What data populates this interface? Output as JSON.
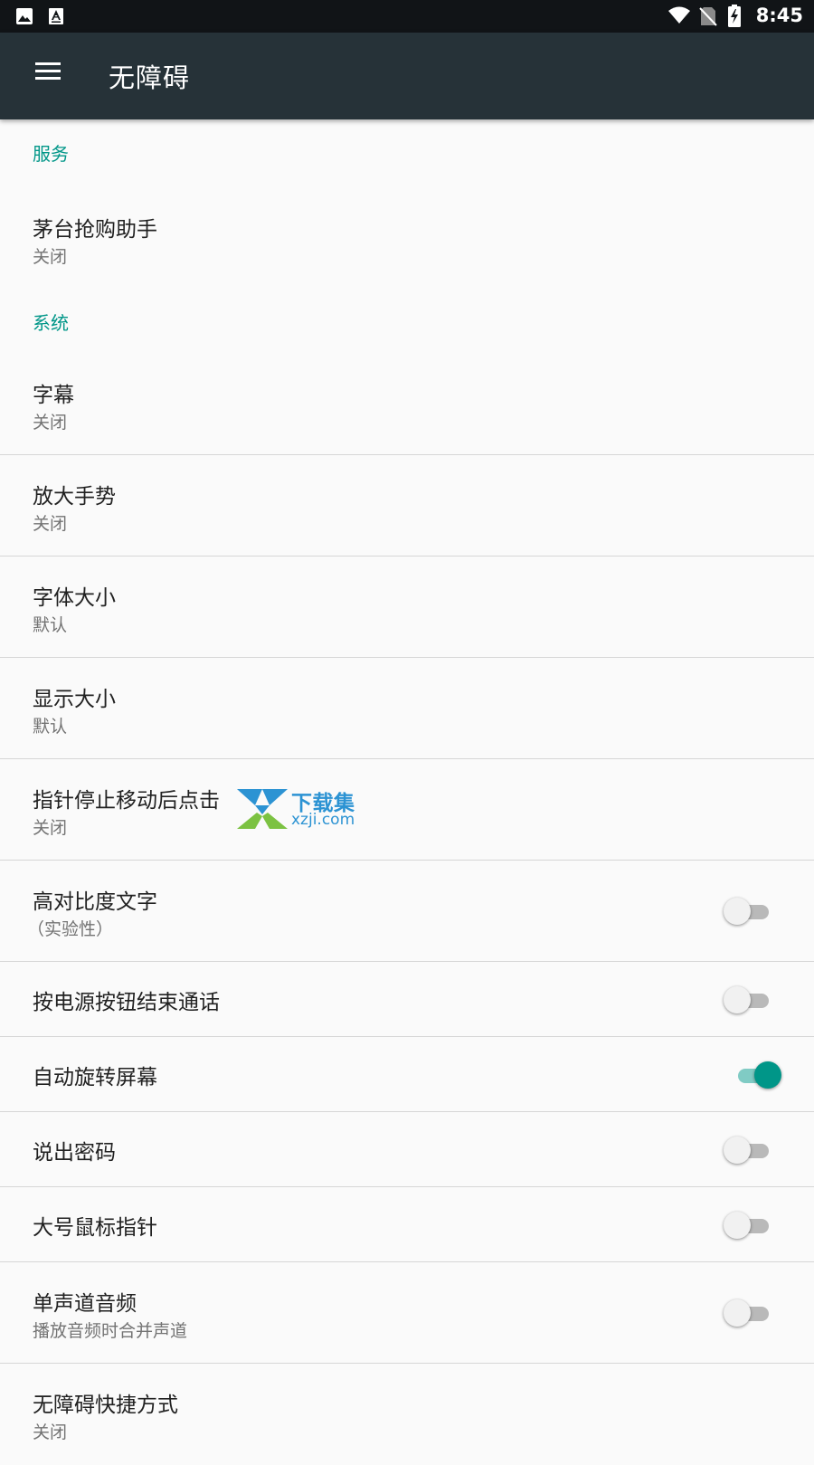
{
  "status_bar": {
    "time": "8:45",
    "icons": [
      "image-icon",
      "text-a-icon",
      "wifi-icon",
      "no-sim-icon",
      "battery-charging-icon"
    ]
  },
  "toolbar": {
    "menu_icon": "hamburger-menu-icon",
    "title": "无障碍"
  },
  "sections": {
    "services": {
      "header": "服务",
      "items": [
        {
          "title": "茅台抢购助手",
          "summary": "关闭"
        }
      ]
    },
    "system": {
      "header": "系统",
      "items": [
        {
          "title": "字幕",
          "summary": "关闭"
        },
        {
          "title": "放大手势",
          "summary": "关闭"
        },
        {
          "title": "字体大小",
          "summary": "默认"
        },
        {
          "title": "显示大小",
          "summary": "默认"
        },
        {
          "title": "指针停止移动后点击",
          "summary": "关闭"
        },
        {
          "title": "高对比度文字",
          "summary": "（实验性）",
          "switch": false
        },
        {
          "title": "按电源按钮结束通话",
          "switch": false
        },
        {
          "title": "自动旋转屏幕",
          "switch": true
        },
        {
          "title": "说出密码",
          "switch": false
        },
        {
          "title": "大号鼠标指针",
          "switch": false
        },
        {
          "title": "单声道音频",
          "summary": "播放音频时合并声道",
          "switch": false
        },
        {
          "title": "无障碍快捷方式",
          "summary": "关闭"
        }
      ]
    }
  },
  "watermark": {
    "title": "下载集",
    "subtitle": "xzji.com"
  },
  "colors": {
    "accent": "#009688",
    "toolbar": "#263238",
    "status_bar": "#111417",
    "background": "#fafafa"
  }
}
